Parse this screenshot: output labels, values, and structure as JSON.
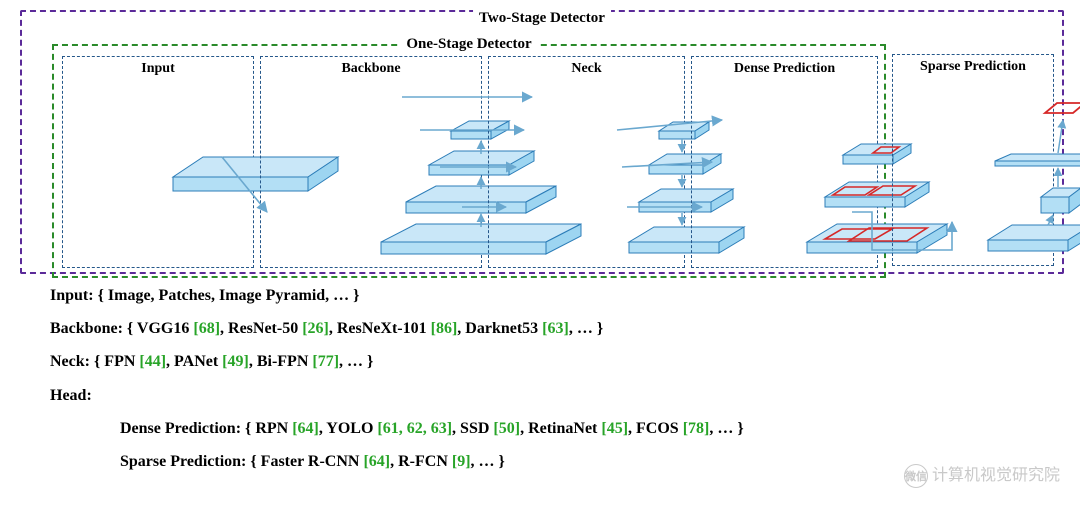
{
  "diagram": {
    "outer_label": "Two-Stage Detector",
    "inner_label": "One-Stage Detector",
    "stages": {
      "input": "Input",
      "backbone": "Backbone",
      "neck": "Neck",
      "dense": "Dense Prediction",
      "sparse": "Sparse Prediction"
    }
  },
  "legend": {
    "input_label": "Input: { Image, Patches, Image Pyramid, … }",
    "backbone_prefix": "Backbone: { VGG16 ",
    "bb_r1": "[68]",
    "bb_t1": ", ResNet-50 ",
    "bb_r2": "[26]",
    "bb_t2": ", ResNeXt-101 ",
    "bb_r3": "[86]",
    "bb_t3": ", Darknet53 ",
    "bb_r4": "[63]",
    "bb_t4": ", … }",
    "neck_prefix": "Neck: { FPN ",
    "nk_r1": "[44]",
    "nk_t1": ", PANet ",
    "nk_r2": "[49]",
    "nk_t2": ", Bi-FPN ",
    "nk_r3": "[77]",
    "nk_t3": ", … }",
    "head_label": "Head:",
    "dense_prefix": "Dense Prediction: { RPN ",
    "dp_r1": "[64]",
    "dp_t1": ", YOLO ",
    "dp_r2": "[61, 62, 63]",
    "dp_t2": ", SSD ",
    "dp_r3": "[50]",
    "dp_t3": ", RetinaNet ",
    "dp_r4": "[45]",
    "dp_t4": ", FCOS ",
    "dp_r5": "[78]",
    "dp_t5": ", … }",
    "sparse_prefix": "Sparse Prediction: { Faster R-CNN ",
    "sp_r1": "[64]",
    "sp_t1": ",  R-FCN ",
    "sp_r2": "[9]",
    "sp_t2": ", … }"
  },
  "watermark": {
    "icon": "微信",
    "text": "计算机视觉研究院"
  }
}
